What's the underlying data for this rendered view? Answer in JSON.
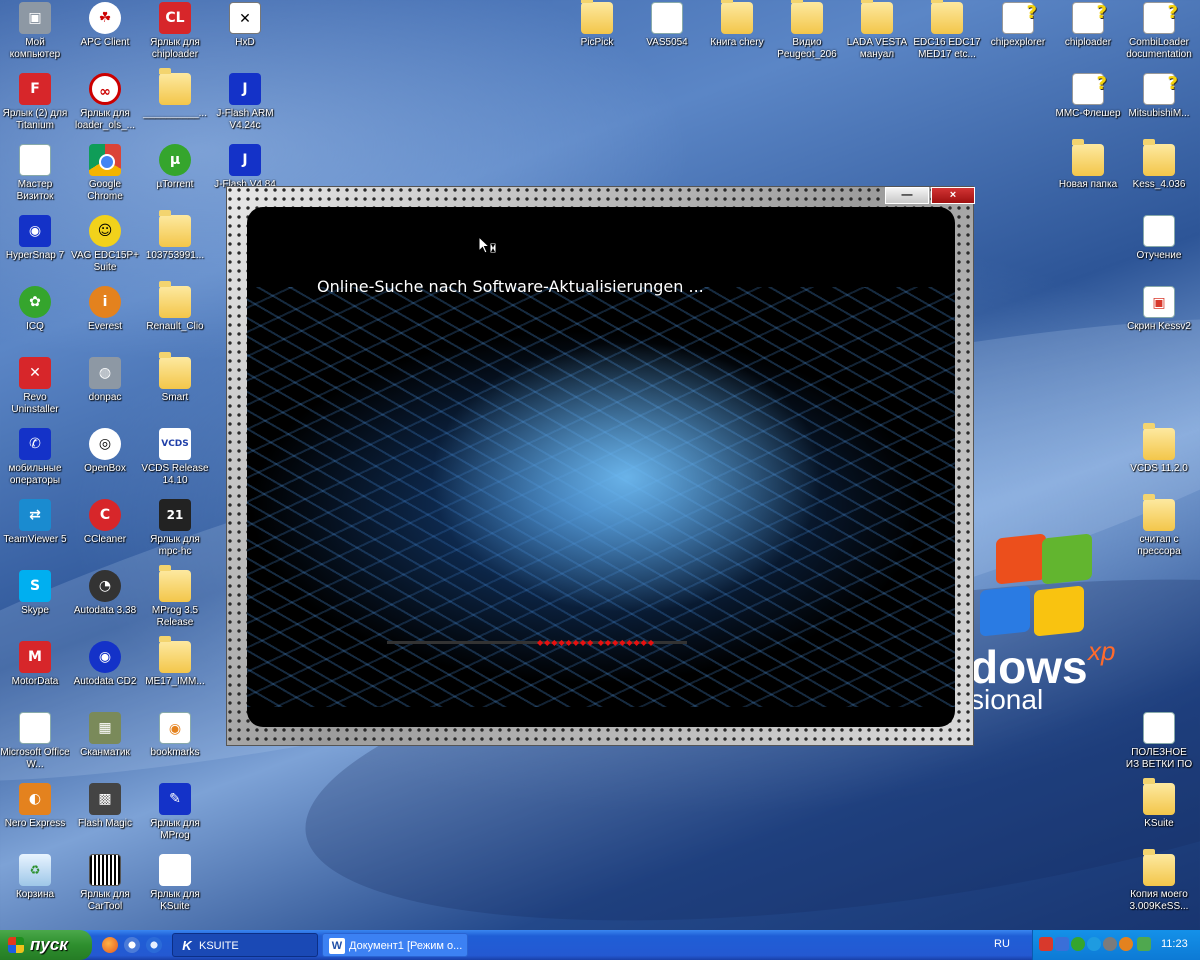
{
  "desktop": {
    "icons": [
      {
        "label": "Мой компьютер",
        "type": "computer"
      },
      {
        "label": "APC Client",
        "type": "app"
      },
      {
        "label": "Ярлык для chiploader",
        "type": "shortcut"
      },
      {
        "label": "HxD",
        "type": "app"
      },
      {
        "label": "Ярлык (2) для Titanium",
        "type": "shortcut"
      },
      {
        "label": "Ярлык для loader_ols_...",
        "type": "shortcut"
      },
      {
        "label": "__________...",
        "type": "folder"
      },
      {
        "label": "J-Flash ARM V4.24c",
        "type": "app"
      },
      {
        "label": "Мастер Визиток",
        "type": "app"
      },
      {
        "label": "Google Chrome",
        "type": "browser"
      },
      {
        "label": "µTorrent",
        "type": "app"
      },
      {
        "label": "J-Flash V4.84",
        "type": "app"
      },
      {
        "label": "HyperSnap 7",
        "type": "app"
      },
      {
        "label": "VAG EDC15P+ Suite",
        "type": "app"
      },
      {
        "label": "103753991...",
        "type": "folder"
      },
      {
        "label": "Ра за",
        "type": "app"
      },
      {
        "label": "ICQ",
        "type": "app"
      },
      {
        "label": "Everest",
        "type": "app"
      },
      {
        "label": "Renault_Clio",
        "type": "folder"
      },
      {
        "label": "От пи",
        "type": "app"
      },
      {
        "label": "Revo Uninstaller",
        "type": "app"
      },
      {
        "label": "donpac",
        "type": "app"
      },
      {
        "label": "Smart",
        "type": "folder"
      },
      {
        "label": "мобильные операторы",
        "type": "app"
      },
      {
        "label": "OpenBox",
        "type": "app"
      },
      {
        "label": "VCDS Release 14.10",
        "type": "app"
      },
      {
        "label": "TeamViewer 5",
        "type": "app"
      },
      {
        "label": "CCleaner",
        "type": "app"
      },
      {
        "label": "Ярлык для mpc-hc",
        "type": "shortcut"
      },
      {
        "label": "Skype",
        "type": "app"
      },
      {
        "label": "Autodata 3.38",
        "type": "app"
      },
      {
        "label": "MProg 3.5 Release",
        "type": "folder"
      },
      {
        "label": "MotorData",
        "type": "app"
      },
      {
        "label": "Autodata CD2",
        "type": "app"
      },
      {
        "label": "ME17_IMM...",
        "type": "folder"
      },
      {
        "label": "Microsoft Office W...",
        "type": "app"
      },
      {
        "label": "Сканматик",
        "type": "app"
      },
      {
        "label": "bookmarks",
        "type": "file"
      },
      {
        "label": "Nero Express",
        "type": "app"
      },
      {
        "label": "Flash Magic",
        "type": "app"
      },
      {
        "label": "Ярлык для MProg",
        "type": "shortcut"
      },
      {
        "label": "Корзина",
        "type": "recycle-bin"
      },
      {
        "label": "Ярлык для CarTool",
        "type": "shortcut"
      },
      {
        "label": "Ярлык для KSuite",
        "type": "shortcut"
      },
      {
        "label": "PicPick",
        "type": "folder"
      },
      {
        "label": "VAS5054",
        "type": "document"
      },
      {
        "label": "Книга chery",
        "type": "folder"
      },
      {
        "label": "Видио Peugeot_206",
        "type": "folder"
      },
      {
        "label": "LADA VESTA мануал",
        "type": "folder"
      },
      {
        "label": "EDC16 EDC17 MED17 etc...",
        "type": "folder"
      },
      {
        "label": "chipexplorer",
        "type": "unknown"
      },
      {
        "label": "chiploader",
        "type": "unknown"
      },
      {
        "label": "CombiLoader documentation",
        "type": "unknown"
      },
      {
        "label": "MMC-Флешер",
        "type": "unknown"
      },
      {
        "label": "MitsubishiM...",
        "type": "unknown"
      },
      {
        "label": "Новая папка",
        "type": "folder"
      },
      {
        "label": "Kess_4.036",
        "type": "folder"
      },
      {
        "label": "Отучение",
        "type": "document"
      },
      {
        "label": "Скрин Kessv2",
        "type": "image"
      },
      {
        "label": "VCDS 11.2.0",
        "type": "folder"
      },
      {
        "label": "считап с прессора",
        "type": "folder"
      },
      {
        "label": "ПОЛЕЗНОЕ ИЗ ВЕТКИ ПО ...",
        "type": "document"
      },
      {
        "label": "KSuite",
        "type": "folder"
      },
      {
        "label": "Копия моего 3.009KeSS...",
        "type": "folder"
      }
    ]
  },
  "wallpaper": {
    "logo_text": "dows",
    "logo_sup": "xp",
    "logo_text2": "sional"
  },
  "dialog": {
    "minimize_label": "—",
    "close_label": "×",
    "status_text": "Online-Suche nach Software-Aktualisierungen ..."
  },
  "taskbar": {
    "start_label": "пуск",
    "tasks": [
      {
        "label": "KSUITE",
        "active": true,
        "icon": "K"
      },
      {
        "label": "Документ1 [Режим о...",
        "active": false,
        "icon": "W"
      }
    ],
    "language": "RU",
    "clock": "11:23"
  },
  "colors": {
    "taskbar_blue": "#2459d2",
    "start_green": "#2e8f2e",
    "close_red": "#c82a2a"
  }
}
